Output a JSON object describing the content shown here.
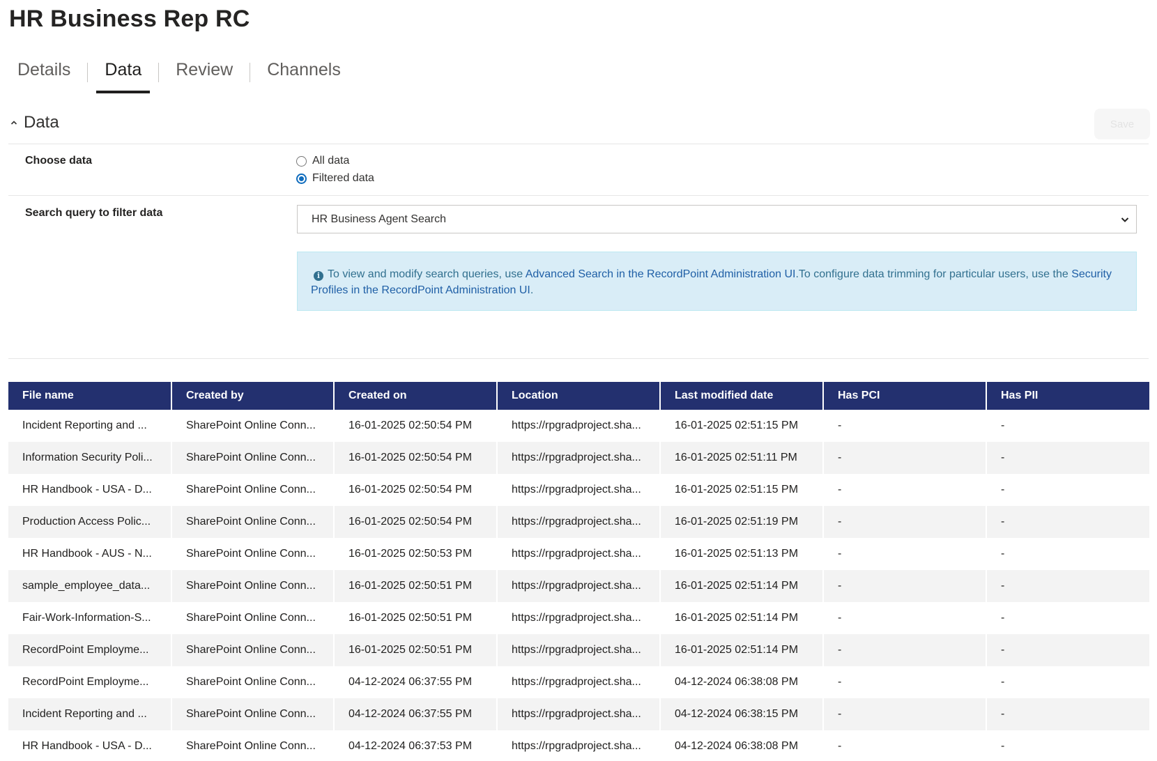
{
  "page": {
    "title": "HR Business Rep RC"
  },
  "tabs": [
    {
      "label": "Details"
    },
    {
      "label": "Data"
    },
    {
      "label": "Review"
    },
    {
      "label": "Channels"
    }
  ],
  "section": {
    "title": "Data",
    "save_label": "Save"
  },
  "choose_data": {
    "label": "Choose data",
    "options": [
      "All data",
      "Filtered data"
    ],
    "selected": "Filtered data"
  },
  "search_query": {
    "label": "Search query to filter data",
    "value": "HR Business Agent Search"
  },
  "info": {
    "text1": "To view and modify search queries, use ",
    "link1": "Advanced Search in the RecordPoint Administration UI",
    "text2": ".To configure data trimming for particular users, use the ",
    "link2": "Security Profiles in the RecordPoint Administration UI",
    "text3": "."
  },
  "table": {
    "columns": [
      "File name",
      "Created by",
      "Created on",
      "Location",
      "Last modified date",
      "Has PCI",
      "Has PII"
    ],
    "rows": [
      [
        "Incident Reporting and ...",
        "SharePoint Online Conn...",
        "16-01-2025 02:50:54 PM",
        "https://rpgradproject.sha...",
        "16-01-2025 02:51:15 PM",
        "-",
        "-"
      ],
      [
        "Information Security Poli...",
        "SharePoint Online Conn...",
        "16-01-2025 02:50:54 PM",
        "https://rpgradproject.sha...",
        "16-01-2025 02:51:11 PM",
        "-",
        "-"
      ],
      [
        "HR Handbook - USA - D...",
        "SharePoint Online Conn...",
        "16-01-2025 02:50:54 PM",
        "https://rpgradproject.sha...",
        "16-01-2025 02:51:15 PM",
        "-",
        "-"
      ],
      [
        "Production Access Polic...",
        "SharePoint Online Conn...",
        "16-01-2025 02:50:54 PM",
        "https://rpgradproject.sha...",
        "16-01-2025 02:51:19 PM",
        "-",
        "-"
      ],
      [
        "HR Handbook - AUS - N...",
        "SharePoint Online Conn...",
        "16-01-2025 02:50:53 PM",
        "https://rpgradproject.sha...",
        "16-01-2025 02:51:13 PM",
        "-",
        "-"
      ],
      [
        "sample_employee_data...",
        "SharePoint Online Conn...",
        "16-01-2025 02:50:51 PM",
        "https://rpgradproject.sha...",
        "16-01-2025 02:51:14 PM",
        "-",
        "-"
      ],
      [
        "Fair-Work-Information-S...",
        "SharePoint Online Conn...",
        "16-01-2025 02:50:51 PM",
        "https://rpgradproject.sha...",
        "16-01-2025 02:51:14 PM",
        "-",
        "-"
      ],
      [
        "RecordPoint Employme...",
        "SharePoint Online Conn...",
        "16-01-2025 02:50:51 PM",
        "https://rpgradproject.sha...",
        "16-01-2025 02:51:14 PM",
        "-",
        "-"
      ],
      [
        "RecordPoint Employme...",
        "SharePoint Online Conn...",
        "04-12-2024 06:37:55 PM",
        "https://rpgradproject.sha...",
        "04-12-2024 06:38:08 PM",
        "-",
        "-"
      ],
      [
        "Incident Reporting and ...",
        "SharePoint Online Conn...",
        "04-12-2024 06:37:55 PM",
        "https://rpgradproject.sha...",
        "04-12-2024 06:38:15 PM",
        "-",
        "-"
      ],
      [
        "HR Handbook - USA - D...",
        "SharePoint Online Conn...",
        "04-12-2024 06:37:53 PM",
        "https://rpgradproject.sha...",
        "04-12-2024 06:38:08 PM",
        "-",
        "-"
      ]
    ]
  }
}
